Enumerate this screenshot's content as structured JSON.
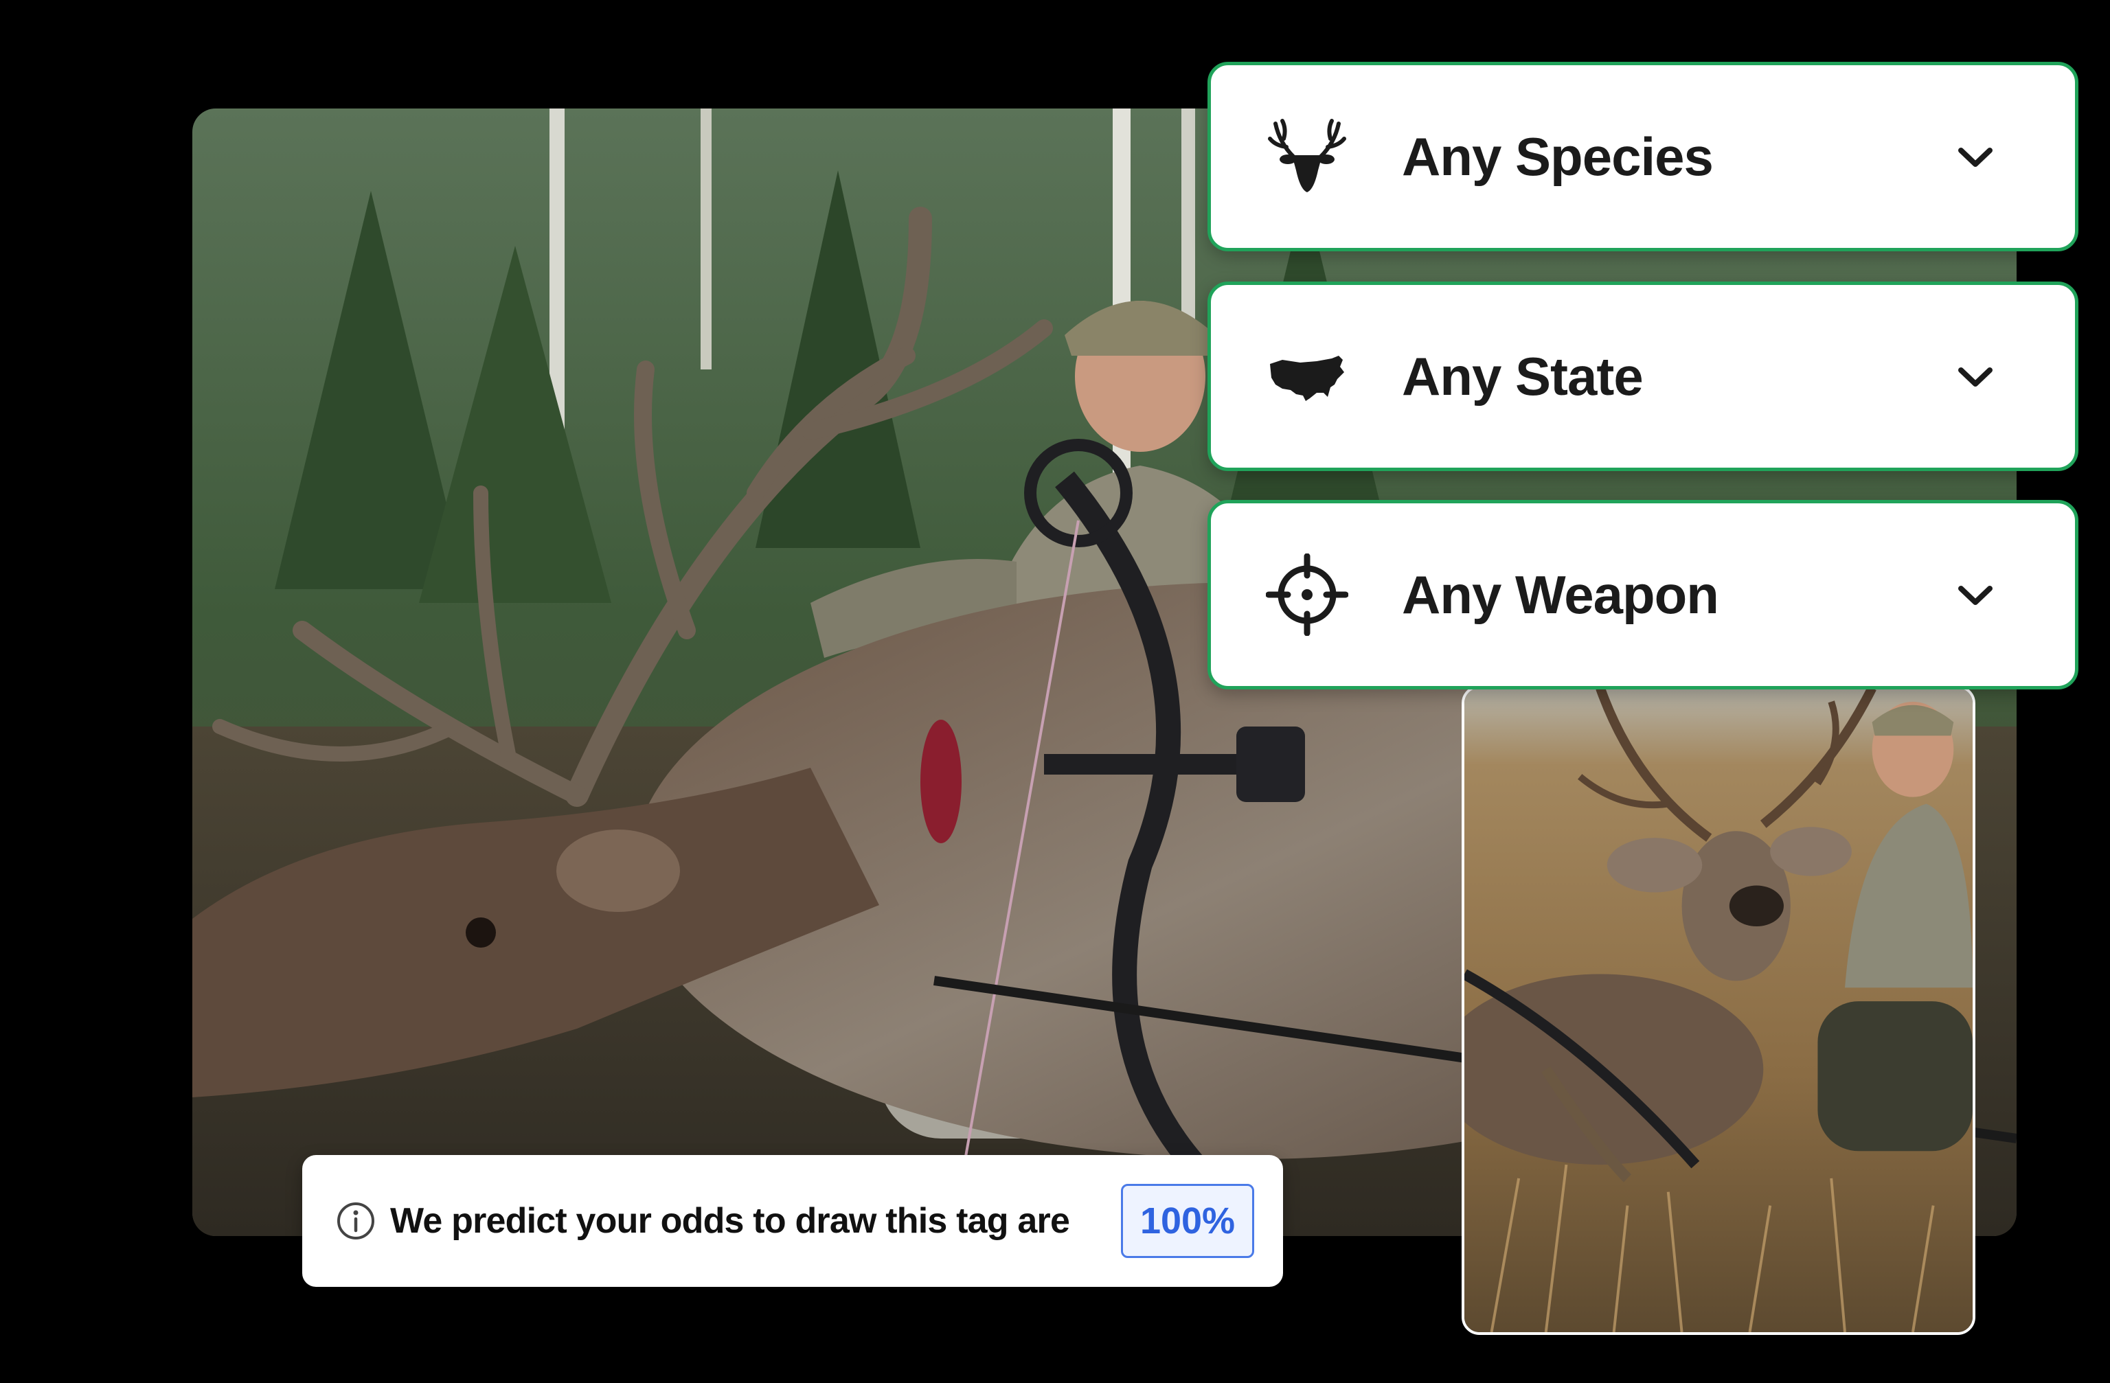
{
  "filters": [
    {
      "label": "Any Species",
      "icon": "deer-head-icon"
    },
    {
      "label": "Any State",
      "icon": "usa-map-icon"
    },
    {
      "label": "Any Weapon",
      "icon": "crosshair-icon"
    }
  ],
  "odds": {
    "text": "We predict your odds to draw this tag are",
    "value": "100%",
    "icon": "info-icon"
  },
  "photos": {
    "main": "hunter-with-elk-photo",
    "secondary": "hunter-with-mule-deer-photo"
  },
  "colors": {
    "background": "#000000",
    "accent_border": "#20a35a",
    "odds_blue": "#2f63e0"
  }
}
